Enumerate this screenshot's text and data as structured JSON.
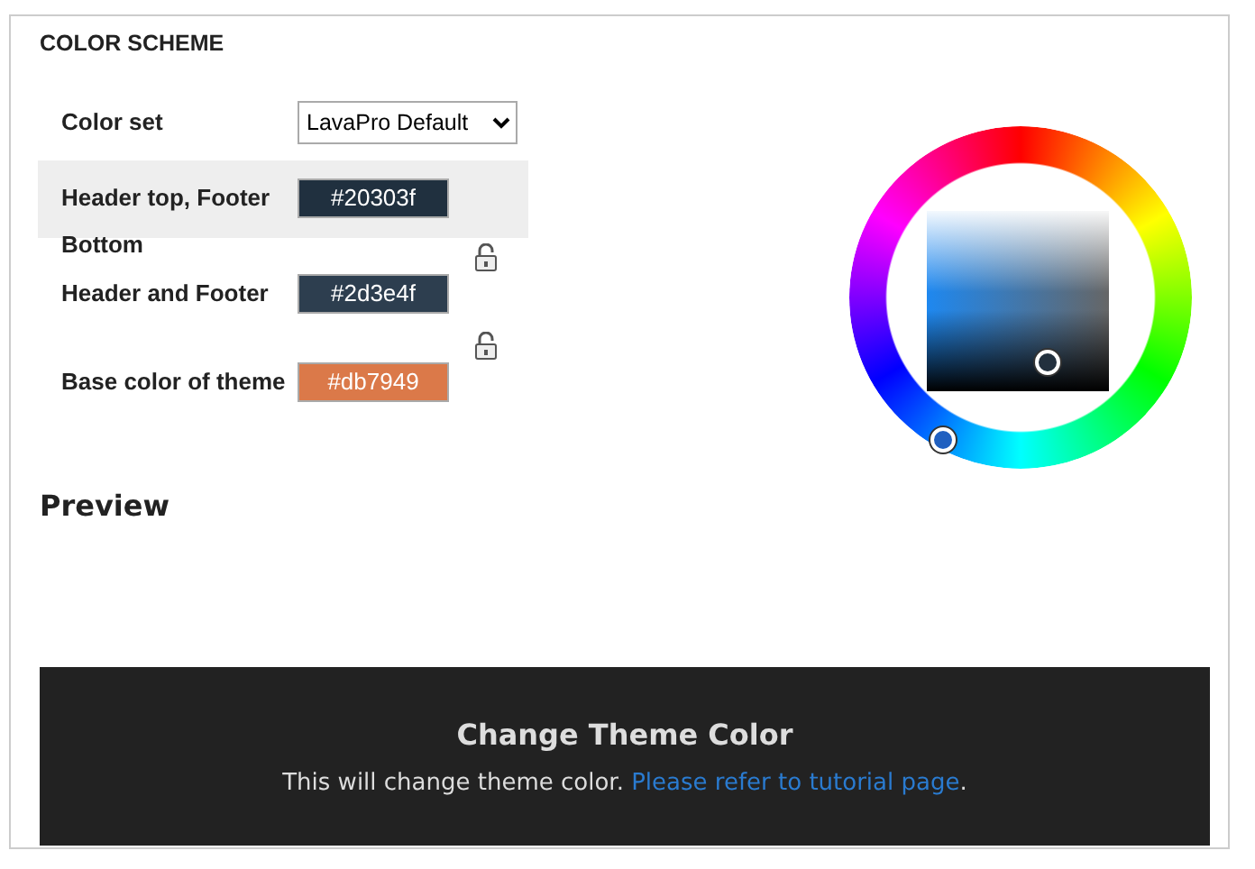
{
  "section_title": "COLOR SCHEME",
  "color_set": {
    "label": "Color set",
    "value": "LavaPro Default"
  },
  "fields": [
    {
      "label": "Header top, Footer Bottom",
      "value": "#20303f",
      "color": "#20303f",
      "selected": true,
      "has_lock": false
    },
    {
      "label": "Header and Footer",
      "value": "#2d3e4f",
      "color": "#2d3e4f",
      "selected": false,
      "has_lock": true
    },
    {
      "label": "Base color of theme",
      "value": "#db7949",
      "color": "#db7949",
      "selected": false,
      "has_lock": true
    }
  ],
  "preview": {
    "heading": "Preview",
    "title": "Change Theme Color",
    "text": "This will change theme color.",
    "link": "Please refer to tutorial page",
    "suffix": "."
  }
}
